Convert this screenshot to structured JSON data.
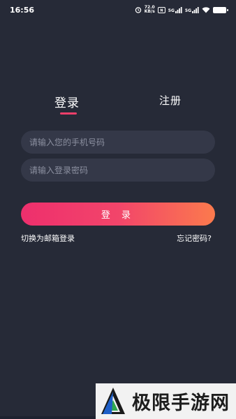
{
  "status_bar": {
    "time": "16:56",
    "speed": "72.0",
    "speed_unit": "KB/s",
    "net1": "5G",
    "net2": "5G",
    "icons": [
      "alarm-icon",
      "nfc-icon",
      "signal-icon",
      "signal-icon",
      "wifi-icon",
      "battery-icon"
    ]
  },
  "tabs": {
    "login": "登录",
    "register": "注册",
    "active": "login",
    "accent_color": "#ef3f6a"
  },
  "form": {
    "phone_placeholder": "请输入您的手机号码",
    "password_placeholder": "请输入登录密码",
    "login_button": "登 录"
  },
  "links": {
    "switch_email": "切换为邮箱登录",
    "forgot_password": "忘记密码?"
  },
  "watermark": {
    "text": "极限手游网"
  },
  "colors": {
    "background": "#262a37",
    "field_bg": "#343848",
    "button_gradient_start": "#ee2f6d",
    "button_gradient_end": "#fb7a4d"
  }
}
